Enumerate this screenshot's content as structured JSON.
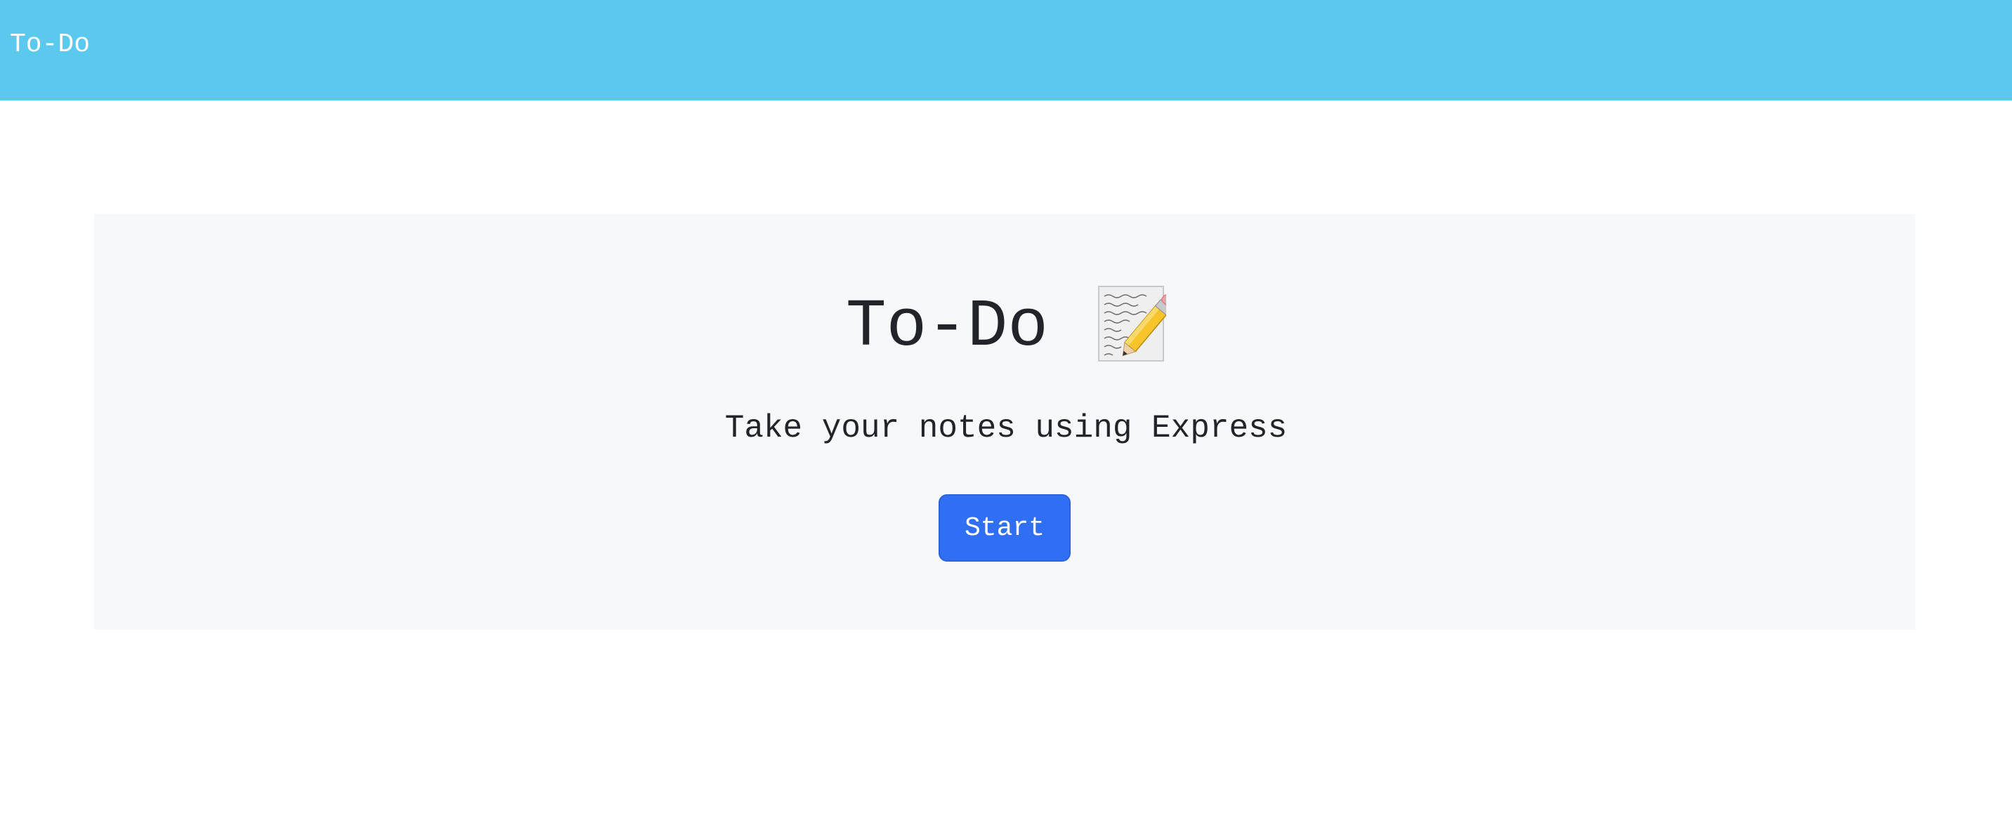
{
  "navbar": {
    "brand": "To-Do",
    "background_color": "#5bc8ed"
  },
  "hero": {
    "title": "To-Do",
    "title_icon": "memo-pencil-icon",
    "subtitle": "Take your notes using Express",
    "start_button": "Start",
    "panel_color": "#f7f8f9",
    "button_color": "#306ff4"
  }
}
